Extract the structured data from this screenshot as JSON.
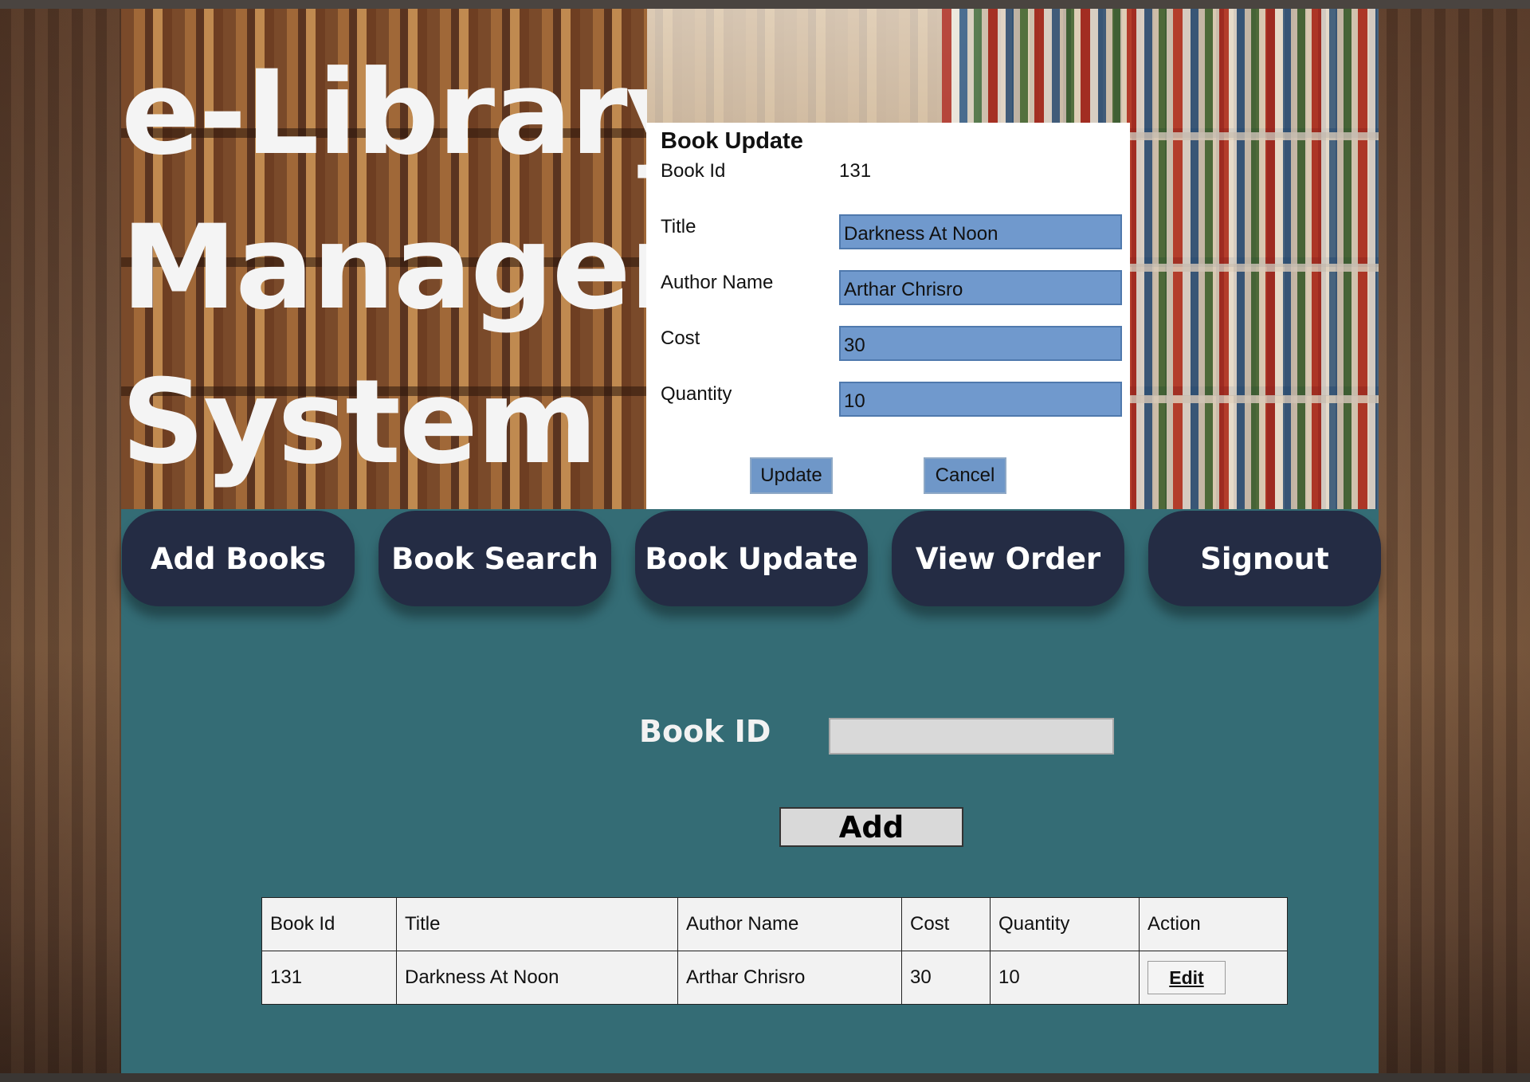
{
  "app": {
    "title_lines": [
      "e-Library",
      "Manager",
      "System"
    ]
  },
  "modal": {
    "title": "Book Update",
    "fields": [
      {
        "label": "Book Id",
        "value": "131"
      },
      {
        "label": "Title",
        "value": "Darkness At Noon"
      },
      {
        "label": "Author Name",
        "value": "Arthar Chrisro"
      },
      {
        "label": "Cost",
        "value": "30"
      },
      {
        "label": "Quantity",
        "value": "10"
      }
    ],
    "update_label": "Update",
    "cancel_label": "Cancel"
  },
  "nav": {
    "items": [
      "Add Books",
      "Book Search",
      "Book Update",
      "View Order",
      "Signout"
    ]
  },
  "search": {
    "book_id_label": "Book ID",
    "book_id_value": "",
    "add_label": "Add"
  },
  "table": {
    "headers": [
      "Book Id",
      "Title",
      "Author Name",
      "Cost",
      "Quantity",
      "Action"
    ],
    "rows": [
      {
        "book_id": "131",
        "title": "Darkness At Noon",
        "author": "Arthar Chrisro",
        "cost": "30",
        "quantity": "10",
        "action": "Edit"
      }
    ]
  },
  "colors": {
    "panel_bg": "#346c75",
    "nav_button": "#242c44",
    "modal_input": "#7099cd"
  }
}
